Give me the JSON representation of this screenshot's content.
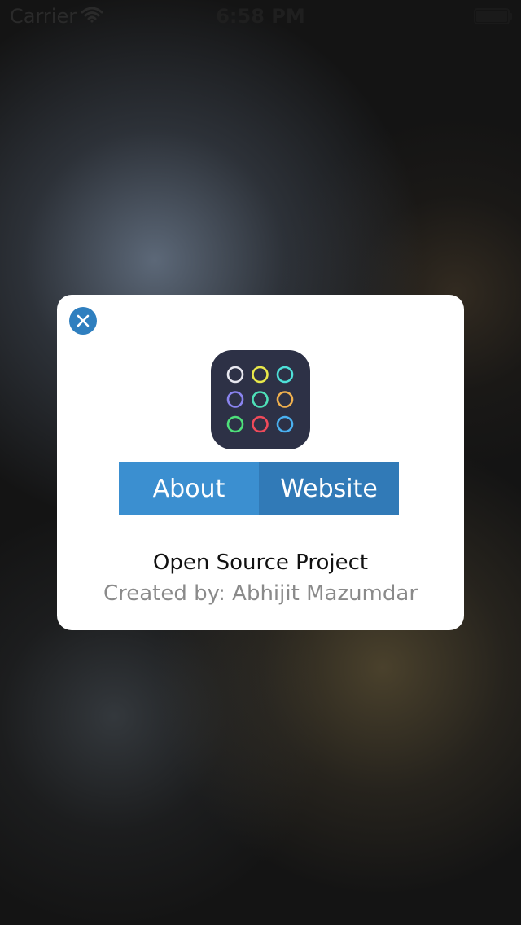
{
  "status_bar": {
    "carrier": "Carrier",
    "time": "6:58 PM",
    "wifi_icon": "wifi-icon",
    "battery_icon": "battery-icon"
  },
  "dialog": {
    "close_icon": "close-icon",
    "app_icon": {
      "name": "app-icon",
      "background": "#2d3146",
      "circle_colors": [
        "#e8e8f0",
        "#e8e84a",
        "#4ee0d8",
        "#8a84f0",
        "#4ee0b8",
        "#f0b04e",
        "#4ee07a",
        "#f04a5a",
        "#4ab0f0"
      ]
    },
    "buttons": {
      "about_label": "About",
      "website_label": "Website"
    },
    "title": "Open Source Project",
    "created_by": "Created by: Abhijit Mazumdar"
  },
  "colors": {
    "accent": "#3b8fd0",
    "accent_dark": "#317ab7",
    "close_button": "#2f7fbf"
  }
}
